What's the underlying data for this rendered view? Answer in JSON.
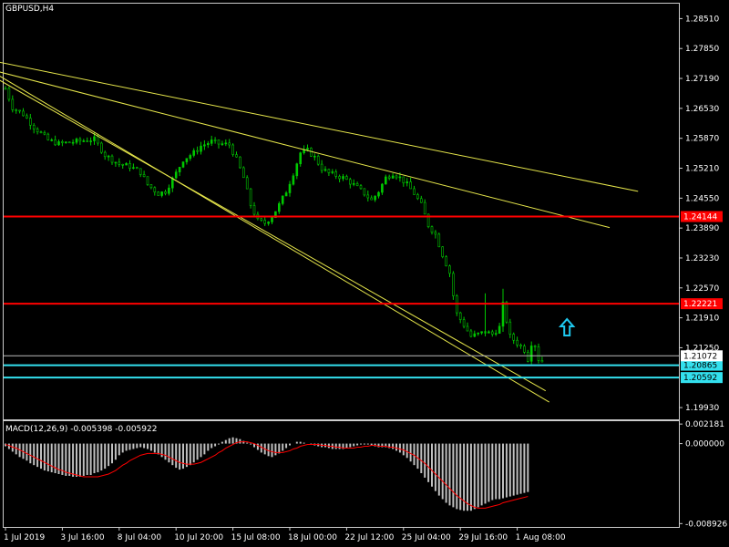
{
  "header": {
    "symbol_label": "GBPUSD,H4",
    "macd_label": "MACD(12,26,9) -0.005398 -0.005922"
  },
  "colors": {
    "background": "#000000",
    "grid": "#cccccc",
    "candle": "#00c800",
    "trendline": "#e6e64b",
    "resistance": "#ff0000",
    "support": "#33e0ee",
    "macd_hist": "#c0c0c0",
    "macd_signal": "#ff0000",
    "arrow": "#1ec8ee",
    "text": "#ffffff"
  },
  "chart_data": [
    {
      "type": "candlestick",
      "title": "GBPUSD,H4",
      "xlabels": [
        "1 Jul 2019",
        "3 Jul 16:00",
        "8 Jul 04:00",
        "10 Jul 20:00",
        "15 Jul 08:00",
        "18 Jul 00:00",
        "22 Jul 12:00",
        "25 Jul 04:00",
        "29 Jul 16:00",
        "1 Aug 08:00"
      ],
      "yticks": [
        "1.28510",
        "1.27850",
        "1.27190",
        "1.26530",
        "1.25870",
        "1.25210",
        "1.24550",
        "1.23890",
        "1.23230",
        "1.22570",
        "1.21910",
        "1.21250",
        "1.19930"
      ],
      "ylim": [
        1.1967,
        1.2884
      ],
      "close_path": [
        [
          0,
          1.2697
        ],
        [
          2,
          1.2655
        ],
        [
          5,
          1.264
        ],
        [
          8,
          1.2612
        ],
        [
          12,
          1.2583
        ],
        [
          15,
          1.2575
        ],
        [
          20,
          1.258
        ],
        [
          25,
          1.2585
        ],
        [
          28,
          1.255
        ],
        [
          32,
          1.253
        ],
        [
          35,
          1.2525
        ],
        [
          38,
          1.2512
        ],
        [
          40,
          1.2485
        ],
        [
          43,
          1.2465
        ],
        [
          45,
          1.247
        ],
        [
          48,
          1.251
        ],
        [
          50,
          1.254
        ],
        [
          53,
          1.2555
        ],
        [
          55,
          1.257
        ],
        [
          58,
          1.258
        ],
        [
          60,
          1.2575
        ],
        [
          63,
          1.2573
        ],
        [
          65,
          1.254
        ],
        [
          67,
          1.25
        ],
        [
          69,
          1.244
        ],
        [
          71,
          1.2405
        ],
        [
          73,
          1.24
        ],
        [
          75,
          1.2415
        ],
        [
          77,
          1.244
        ],
        [
          79,
          1.247
        ],
        [
          81,
          1.251
        ],
        [
          83,
          1.2555
        ],
        [
          85,
          1.256
        ],
        [
          87,
          1.2545
        ],
        [
          89,
          1.252
        ],
        [
          91,
          1.251
        ],
        [
          93,
          1.2505
        ],
        [
          95,
          1.25
        ],
        [
          97,
          1.249
        ],
        [
          99,
          1.2478
        ],
        [
          101,
          1.2465
        ],
        [
          103,
          1.245
        ],
        [
          105,
          1.247
        ],
        [
          107,
          1.25
        ],
        [
          109,
          1.251
        ],
        [
          111,
          1.25
        ],
        [
          113,
          1.2485
        ],
        [
          115,
          1.2465
        ],
        [
          117,
          1.244
        ],
        [
          119,
          1.2395
        ],
        [
          121,
          1.2375
        ],
        [
          123,
          1.233
        ],
        [
          125,
          1.229
        ],
        [
          126,
          1.224
        ],
        [
          127,
          1.22
        ],
        [
          129,
          1.2175
        ],
        [
          131,
          1.215
        ],
        [
          133,
          1.2155
        ],
        [
          135,
          1.216
        ],
        [
          137,
          1.2155
        ],
        [
          139,
          1.217
        ],
        [
          140,
          1.222
        ],
        [
          141,
          1.2185
        ],
        [
          142,
          1.215
        ],
        [
          144,
          1.2135
        ],
        [
          146,
          1.212
        ],
        [
          147,
          1.21
        ],
        [
          148,
          1.2135
        ],
        [
          149,
          1.213
        ],
        [
          150,
          1.21
        ],
        [
          151,
          1.2095
        ]
      ],
      "trendlines": [
        {
          "x1": -5,
          "y1": 1.273,
          "x2": 152,
          "y2": 1.203
        },
        {
          "x1": -5,
          "y1": 1.274,
          "x2": 153,
          "y2": 1.2005
        },
        {
          "x1": -5,
          "y1": 1.276,
          "x2": 178,
          "y2": 1.247
        },
        {
          "x1": -5,
          "y1": 1.274,
          "x2": 170,
          "y2": 1.239
        }
      ],
      "horizontal_lines": [
        {
          "value": 1.24144,
          "label": "1.24144",
          "kind": "resistance"
        },
        {
          "value": 1.22221,
          "label": "1.22221",
          "kind": "resistance"
        },
        {
          "value": 1.20865,
          "label": "1.20865",
          "kind": "support"
        },
        {
          "value": 1.20592,
          "label": "1.20592",
          "kind": "support"
        }
      ],
      "current_price": {
        "value": 1.21072,
        "label": "1.21072"
      },
      "arrow": {
        "x": 158,
        "value": 1.217,
        "direction": "up"
      }
    },
    {
      "type": "bar",
      "title": "MACD(12,26,9) -0.005398 -0.005922",
      "yticks": [
        "0.002181",
        "0.000000",
        "-0.008926"
      ],
      "ylim": [
        -0.0093,
        0.0025
      ],
      "macd": [
        -0.0003,
        -0.0006,
        -0.0009,
        -0.0012,
        -0.0015,
        -0.0017,
        -0.0019,
        -0.0022,
        -0.0024,
        -0.0026,
        -0.0028,
        -0.003,
        -0.0031,
        -0.0032,
        -0.0033,
        -0.0034,
        -0.0035,
        -0.0036,
        -0.0036,
        -0.0037,
        -0.0037,
        -0.0037,
        -0.0036,
        -0.0035,
        -0.0035,
        -0.0033,
        -0.0032,
        -0.003,
        -0.0028,
        -0.0025,
        -0.0022,
        -0.0018,
        -0.0013,
        -0.001,
        -0.0008,
        -0.0007,
        -0.0006,
        -0.0005,
        -0.0004,
        -0.0005,
        -0.0006,
        -0.0008,
        -0.001,
        -0.0012,
        -0.0015,
        -0.0018,
        -0.0021,
        -0.0024,
        -0.0027,
        -0.0029,
        -0.0028,
        -0.0026,
        -0.0024,
        -0.0021,
        -0.0018,
        -0.0015,
        -0.0012,
        -0.0008,
        -0.0005,
        -0.0003,
        -0.0001,
        0.0002,
        0.0004,
        0.0006,
        0.0007,
        0.0006,
        0.0005,
        0.0003,
        0.0001,
        -0.0001,
        -0.0004,
        -0.0007,
        -0.001,
        -0.0012,
        -0.0014,
        -0.0015,
        -0.0013,
        -0.0011,
        -0.0008,
        -0.0005,
        -0.0002,
        0.0,
        0.0002,
        0.0002,
        0.0001,
        0.0,
        -0.0001,
        -0.0002,
        -0.0003,
        -0.0004,
        -0.0004,
        -0.0005,
        -0.0006,
        -0.0006,
        -0.0006,
        -0.0006,
        -0.0005,
        -0.0004,
        -0.0003,
        -0.0002,
        -0.0001,
        -0.0001,
        -0.0001,
        -0.0002,
        -0.0003,
        -0.0004,
        -0.0004,
        -0.0004,
        -0.0005,
        -0.0006,
        -0.0008,
        -0.001,
        -0.0013,
        -0.0016,
        -0.002,
        -0.0024,
        -0.0028,
        -0.0033,
        -0.0038,
        -0.0043,
        -0.0048,
        -0.0053,
        -0.0058,
        -0.0062,
        -0.0066,
        -0.0069,
        -0.0071,
        -0.0073,
        -0.0074,
        -0.0075,
        -0.0075,
        -0.0075,
        -0.0073,
        -0.0071,
        -0.0069,
        -0.0067,
        -0.0065,
        -0.0063,
        -0.0062,
        -0.0062,
        -0.0061,
        -0.006,
        -0.0059,
        -0.0058,
        -0.0057,
        -0.0056,
        -0.0055,
        -0.0054
      ],
      "signal": [
        -0.0001,
        -0.0002,
        -0.0004,
        -0.0005,
        -0.0007,
        -0.0009,
        -0.0011,
        -0.0013,
        -0.0015,
        -0.0017,
        -0.0019,
        -0.0021,
        -0.0023,
        -0.0025,
        -0.0027,
        -0.0029,
        -0.003,
        -0.0032,
        -0.0033,
        -0.0034,
        -0.0035,
        -0.0036,
        -0.0037,
        -0.0037,
        -0.0037,
        -0.0037,
        -0.0037,
        -0.0036,
        -0.0035,
        -0.0034,
        -0.0032,
        -0.003,
        -0.0027,
        -0.0024,
        -0.0022,
        -0.0019,
        -0.0017,
        -0.0015,
        -0.0013,
        -0.0012,
        -0.0011,
        -0.0011,
        -0.0011,
        -0.0011,
        -0.0012,
        -0.0013,
        -0.0015,
        -0.0017,
        -0.0019,
        -0.0021,
        -0.0022,
        -0.0023,
        -0.0023,
        -0.0023,
        -0.0022,
        -0.0021,
        -0.0019,
        -0.0017,
        -0.0015,
        -0.0013,
        -0.001,
        -0.0008,
        -0.0005,
        -0.0003,
        -0.0001,
        0.0001,
        0.0002,
        0.0002,
        0.0002,
        0.0001,
        0.0,
        -0.0002,
        -0.0004,
        -0.0006,
        -0.0008,
        -0.0009,
        -0.001,
        -0.001,
        -0.001,
        -0.0009,
        -0.0008,
        -0.0006,
        -0.0005,
        -0.0003,
        -0.0002,
        -0.0001,
        -0.0001,
        -0.0001,
        -0.0001,
        -0.0002,
        -0.0002,
        -0.0003,
        -0.0003,
        -0.0004,
        -0.0004,
        -0.0005,
        -0.0005,
        -0.0005,
        -0.0005,
        -0.0004,
        -0.0004,
        -0.0003,
        -0.0003,
        -0.0002,
        -0.0002,
        -0.0003,
        -0.0003,
        -0.0003,
        -0.0004,
        -0.0004,
        -0.0005,
        -0.0006,
        -0.0007,
        -0.0009,
        -0.0011,
        -0.0013,
        -0.0016,
        -0.0019,
        -0.0022,
        -0.0026,
        -0.003,
        -0.0034,
        -0.0038,
        -0.0042,
        -0.0046,
        -0.005,
        -0.0054,
        -0.0058,
        -0.0061,
        -0.0064,
        -0.0067,
        -0.0069,
        -0.0071,
        -0.0072,
        -0.0072,
        -0.0072,
        -0.0071,
        -0.007,
        -0.0069,
        -0.0068,
        -0.0066,
        -0.0065,
        -0.0064,
        -0.0063,
        -0.0062,
        -0.0061,
        -0.006,
        -0.0059
      ]
    }
  ]
}
